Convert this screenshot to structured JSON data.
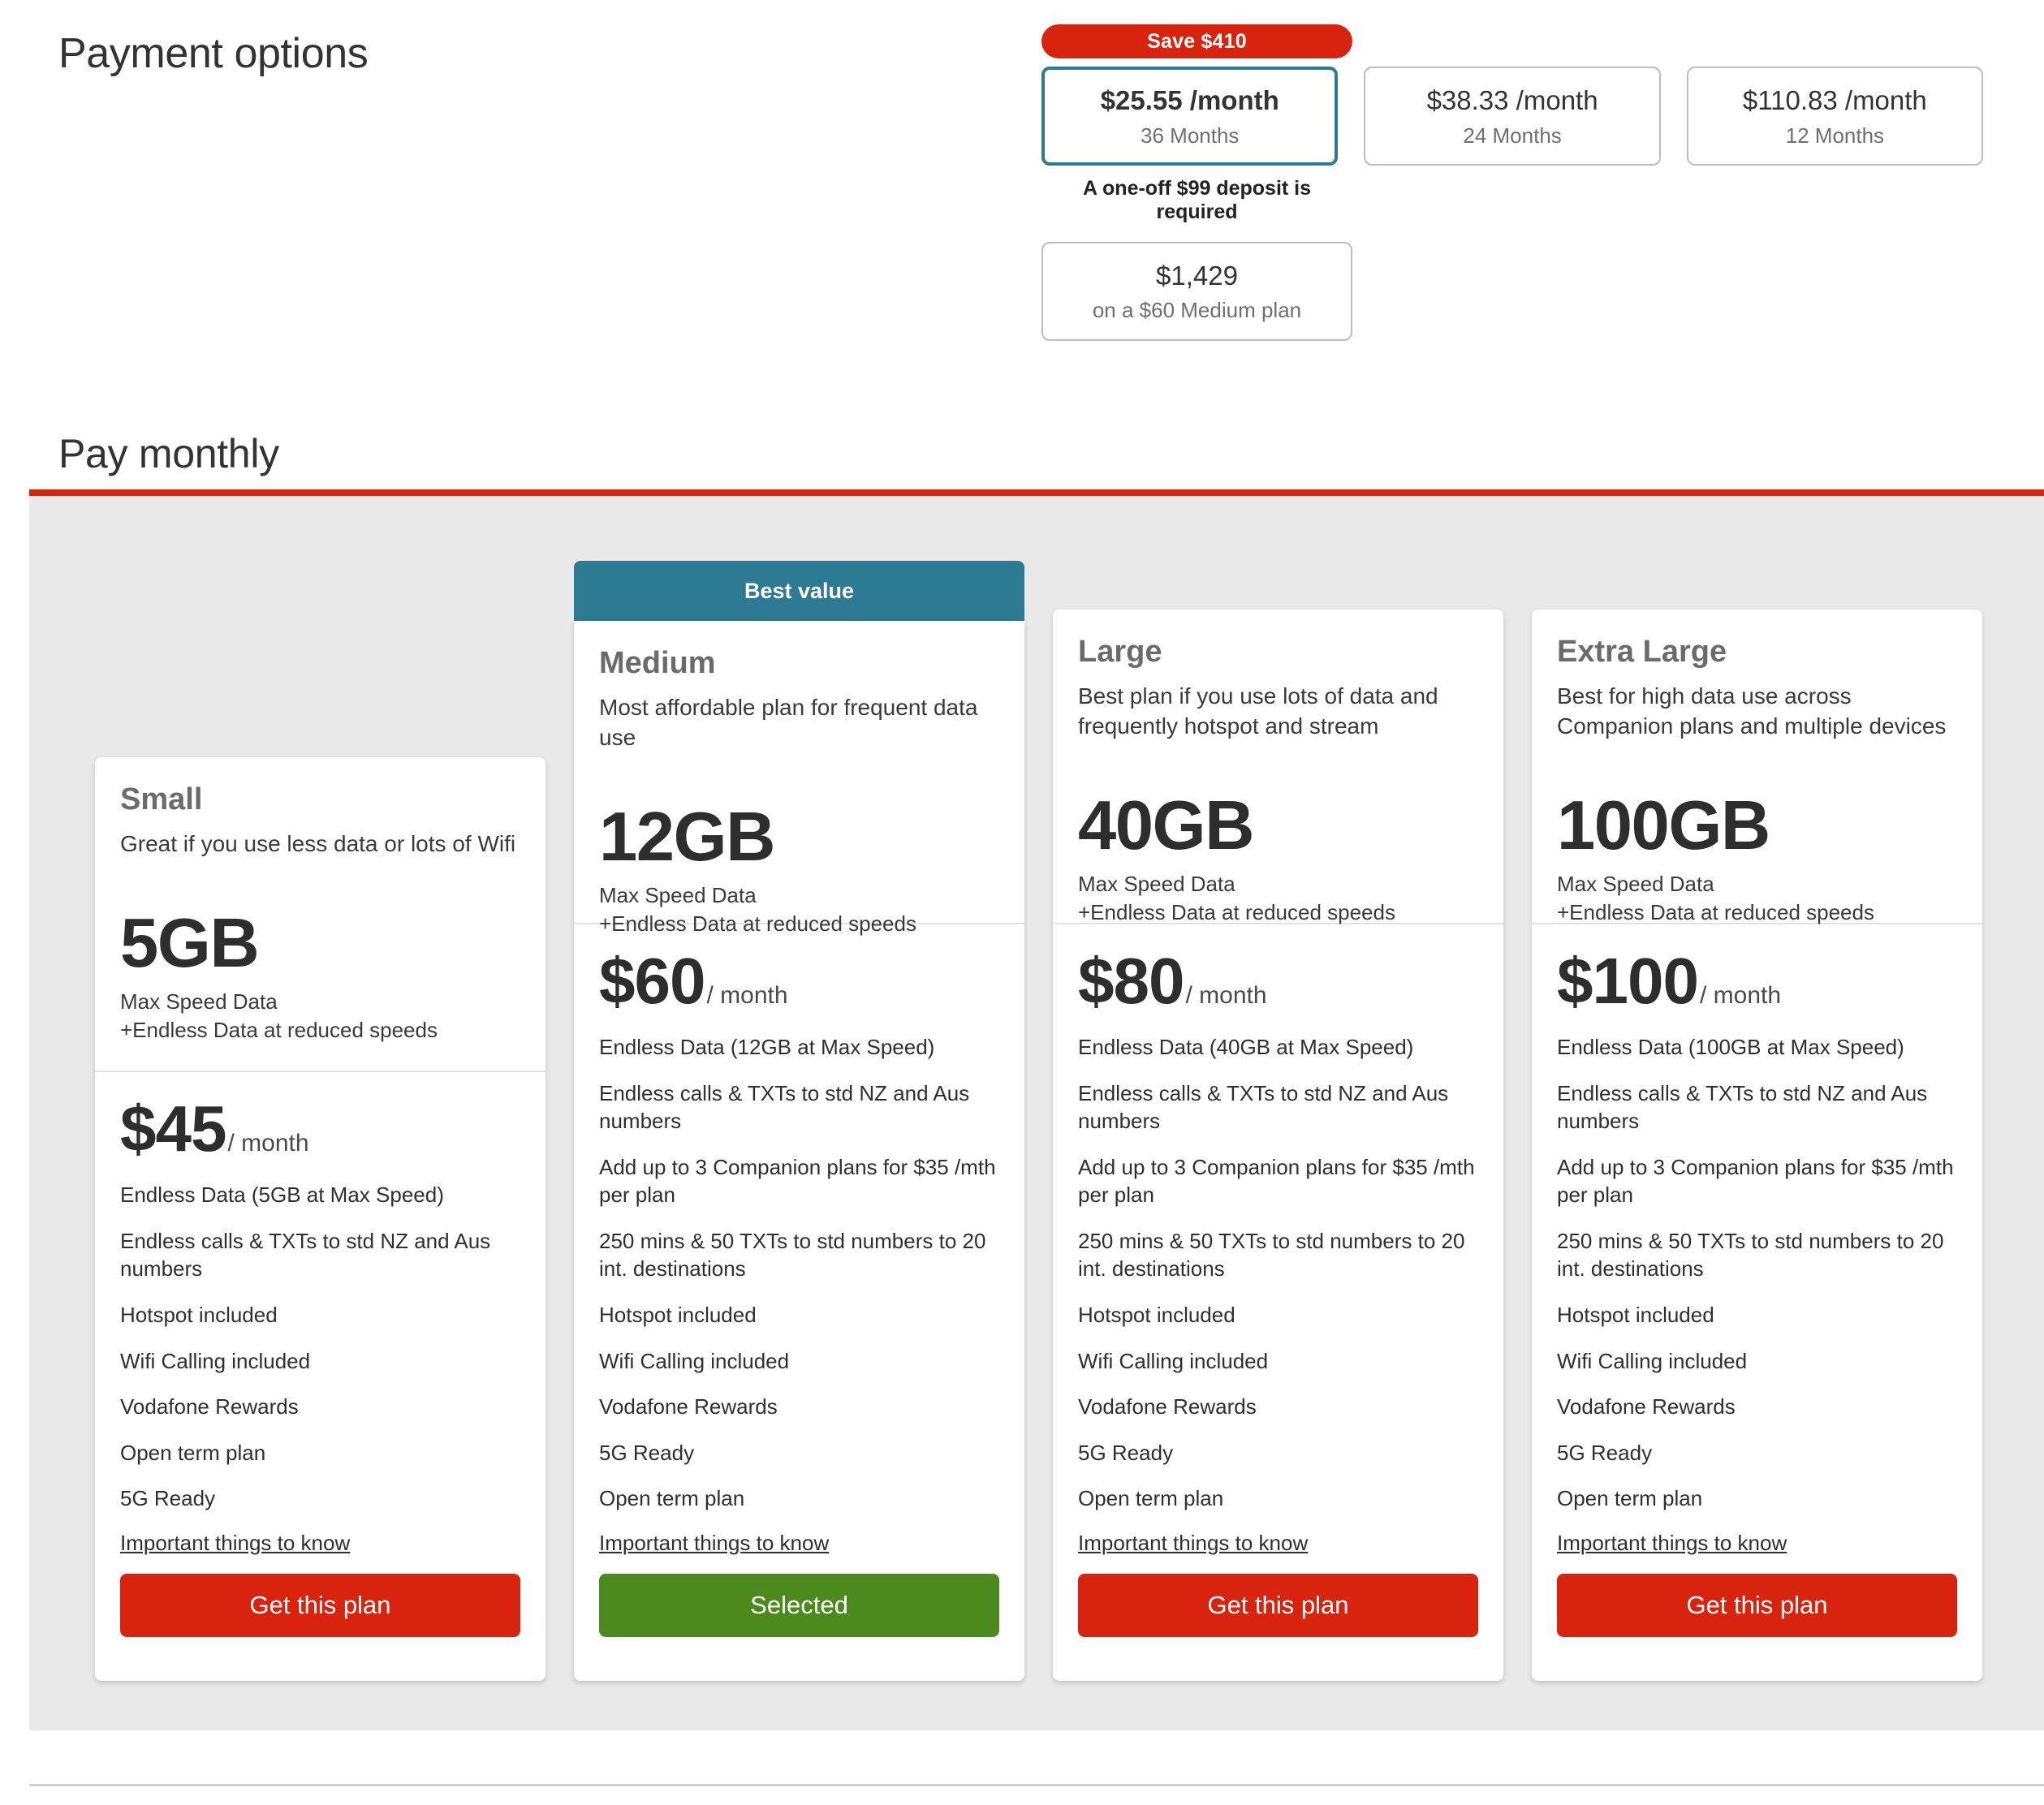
{
  "header": {
    "payment_options_title": "Payment options",
    "pay_monthly_title": "Pay monthly"
  },
  "colors": {
    "brand_red": "#d8230f",
    "accent_teal": "#2c7b92",
    "selected_green": "#4c8a1d",
    "panel_grey": "#e9e9e9"
  },
  "payment_options": {
    "save_badge": "Save $410",
    "deposit_note": "A one-off $99 deposit is required",
    "terms": [
      {
        "price": "$25.55 /month",
        "duration": "36 Months",
        "selected": true
      },
      {
        "price": "$38.33 /month",
        "duration": "24 Months",
        "selected": false
      },
      {
        "price": "$110.83 /month",
        "duration": "12 Months",
        "selected": false
      }
    ],
    "total": {
      "amount": "$1,429",
      "sub": "on a $60 Medium plan"
    }
  },
  "plans": [
    {
      "banner": "",
      "name": "Small",
      "tagline": "Great if you use less data or lots of Wifi",
      "data": "5GB",
      "data_sub_1": "Max Speed Data",
      "data_sub_2": "+Endless Data at reduced speeds",
      "price": "$45",
      "period": "/ month",
      "features": [
        "Endless Data (5GB at Max Speed)",
        "Endless calls & TXTs to std NZ and Aus numbers",
        "Hotspot included",
        "Wifi Calling included",
        "Vodafone Rewards",
        "Open term plan",
        "5G Ready"
      ],
      "info_link": "Important things to know",
      "cta_label": "Get this plan",
      "cta_state": "default"
    },
    {
      "banner": "Best value",
      "name": "Medium",
      "tagline": "Most affordable plan for frequent data use",
      "data": "12GB",
      "data_sub_1": "Max Speed Data",
      "data_sub_2": "+Endless Data at reduced speeds",
      "price": "$60",
      "period": "/ month",
      "features": [
        "Endless Data (12GB at Max Speed)",
        "Endless calls & TXTs to std NZ and Aus numbers",
        "Add up to 3 Companion plans for $35 /mth per plan",
        "250 mins & 50 TXTs to std numbers to 20 int. destinations",
        "Hotspot included",
        "Wifi Calling included",
        "Vodafone Rewards",
        "5G Ready",
        "Open term plan"
      ],
      "info_link": "Important things to know",
      "cta_label": "Selected",
      "cta_state": "selected"
    },
    {
      "banner": "",
      "name": "Large",
      "tagline": "Best plan if you use lots of data and frequently hotspot and stream",
      "data": "40GB",
      "data_sub_1": "Max Speed Data",
      "data_sub_2": "+Endless Data at reduced speeds",
      "price": "$80",
      "period": "/ month",
      "features": [
        "Endless Data (40GB at Max Speed)",
        "Endless calls & TXTs to std NZ and Aus numbers",
        "Add up to 3 Companion plans for $35 /mth per plan",
        "250 mins & 50 TXTs to std numbers to 20 int. destinations",
        "Hotspot included",
        "Wifi Calling included",
        "Vodafone Rewards",
        "5G Ready",
        "Open term plan"
      ],
      "info_link": "Important things to know",
      "cta_label": "Get this plan",
      "cta_state": "default"
    },
    {
      "banner": "",
      "name": "Extra Large",
      "tagline": "Best for high data use across Companion plans and multiple devices",
      "data": "100GB",
      "data_sub_1": "Max Speed Data",
      "data_sub_2": "+Endless Data at reduced speeds",
      "price": "$100",
      "period": "/ month",
      "features": [
        "Endless Data (100GB at Max Speed)",
        "Endless calls & TXTs to std NZ and Aus numbers",
        "Add up to 3 Companion plans for $35 /mth per plan",
        "250 mins & 50 TXTs to std numbers to 20 int. destinations",
        "Hotspot included",
        "Wifi Calling included",
        "Vodafone Rewards",
        "5G Ready",
        "Open term plan"
      ],
      "info_link": "Important things to know",
      "cta_label": "Get this plan",
      "cta_state": "default"
    }
  ]
}
